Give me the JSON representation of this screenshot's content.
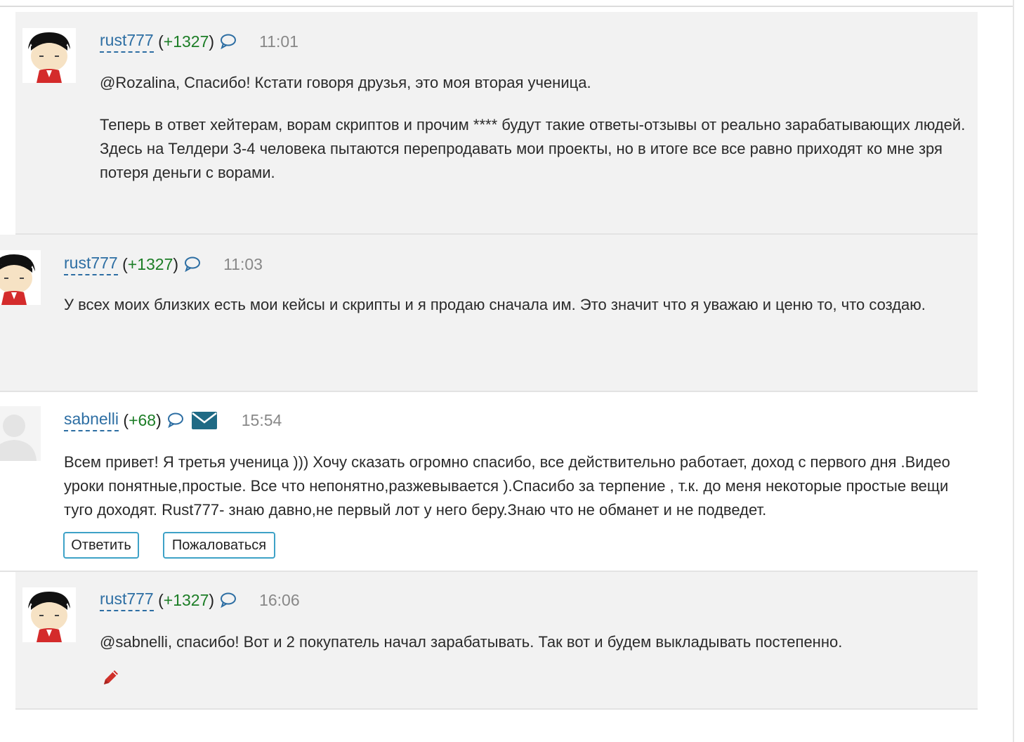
{
  "comments": [
    {
      "username": "rust777",
      "rating": "+1327",
      "time": "11:01",
      "paragraphs": [
        "@Rozalina, Спасибо! Кстати говоря друзья, это моя вторая ученица.",
        "Теперь в ответ хейтерам, ворам скриптов и прочим **** будут такие ответы-отзывы от реально зарабатывающих людей. Здесь на Телдери 3-4 человека пытаются перепродавать мои проекты, но в итоге все все равно приходят ко мне зря потеря деньги с ворами."
      ]
    },
    {
      "username": "rust777",
      "rating": "+1327",
      "time": "11:03",
      "paragraphs": [
        "У всех моих близких есть мои кейсы и скрипты и я продаю сначала им. Это значит что я уважаю и ценю то, что создаю."
      ]
    },
    {
      "username": "sabnelli",
      "rating": "+68",
      "time": "15:54",
      "paragraphs": [
        "Всем привет! Я третья ученица ))) Хочу сказать огромно спасибо, все действительно работает, доход с первого дня .Видео уроки понятные,простые. Все что непонятно,разжевывается ).Спасибо за терпение , т.к. до меня некоторые простые вещи туго доходят. Rust777- знаю давно,не первый лот у него беру.Знаю что не обманет и не подведет."
      ],
      "buttons": {
        "reply": "Ответить",
        "report": "Пожаловаться"
      }
    },
    {
      "username": "rust777",
      "rating": "+1327",
      "time": "16:06",
      "paragraphs": [
        "@sabnelli, спасибо! Вот и 2 покупатель начал зарабатывать. Так вот и будем выкладывать постепенно."
      ]
    }
  ],
  "colors": {
    "username": "#2d6ea3",
    "rating": "#1c7d26",
    "time": "#888888",
    "button_border": "#3ea2c7",
    "envelope": "#1f6a85",
    "pencil": "#d0302a"
  },
  "icons": {
    "comment": "speech-bubble-icon",
    "message": "envelope-icon",
    "edit": "pencil-icon",
    "default_avatar": "default-user-silhouette"
  }
}
